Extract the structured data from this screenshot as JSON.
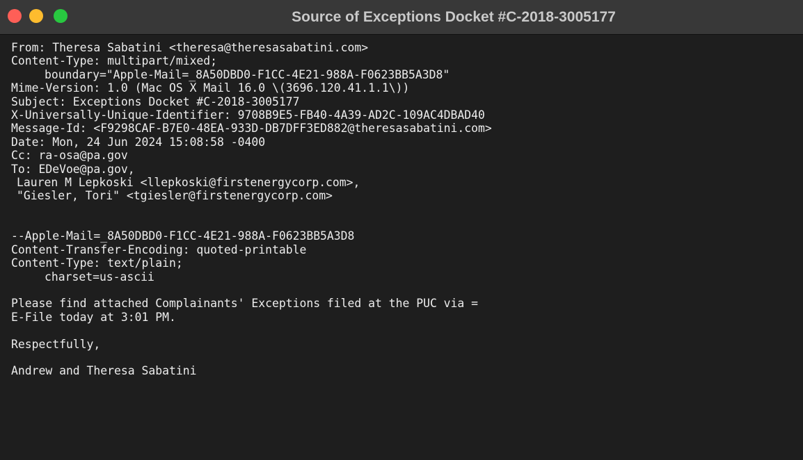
{
  "window": {
    "title": "Source of Exceptions Docket #C-2018-3005177",
    "colors": {
      "close": "#fe5f57",
      "minimize": "#febc2e",
      "maximize": "#28c840",
      "background": "#1e1e1e",
      "text": "#ececec"
    }
  },
  "message": {
    "lines": [
      "From: Theresa Sabatini <theresa@theresasabatini.com>",
      "Content-Type: multipart/mixed;",
      "boundary=\"Apple-Mail=_8A50DBD0-F1CC-4E21-988A-F0623BB5A3D8\"",
      "Mime-Version: 1.0 (Mac OS X Mail 16.0 \\(3696.120.41.1.1\\))",
      "Subject: Exceptions Docket #C-2018-3005177",
      "X-Universally-Unique-Identifier: 9708B9E5-FB40-4A39-AD2C-109AC4DBAD40",
      "Message-Id: <F9298CAF-B7E0-48EA-933D-DB7DFF3ED882@theresasabatini.com>",
      "Date: Mon, 24 Jun 2024 15:08:58 -0400",
      "Cc: ra-osa@pa.gov",
      "To: EDeVoe@pa.gov,",
      "Lauren M Lepkoski <llepkoski@firstenergycorp.com>,",
      "\"Giesler, Tori\" <tgiesler@firstenergycorp.com>",
      "",
      "",
      "--Apple-Mail=_8A50DBD0-F1CC-4E21-988A-F0623BB5A3D8",
      "Content-Transfer-Encoding: quoted-printable",
      "Content-Type: text/plain;",
      "charset=us-ascii",
      "",
      "Please find attached Complainants' Exceptions filed at the PUC via =",
      "E-File today at 3:01 PM.",
      "",
      "Respectfully,",
      "",
      "Andrew and Theresa Sabatini"
    ]
  }
}
